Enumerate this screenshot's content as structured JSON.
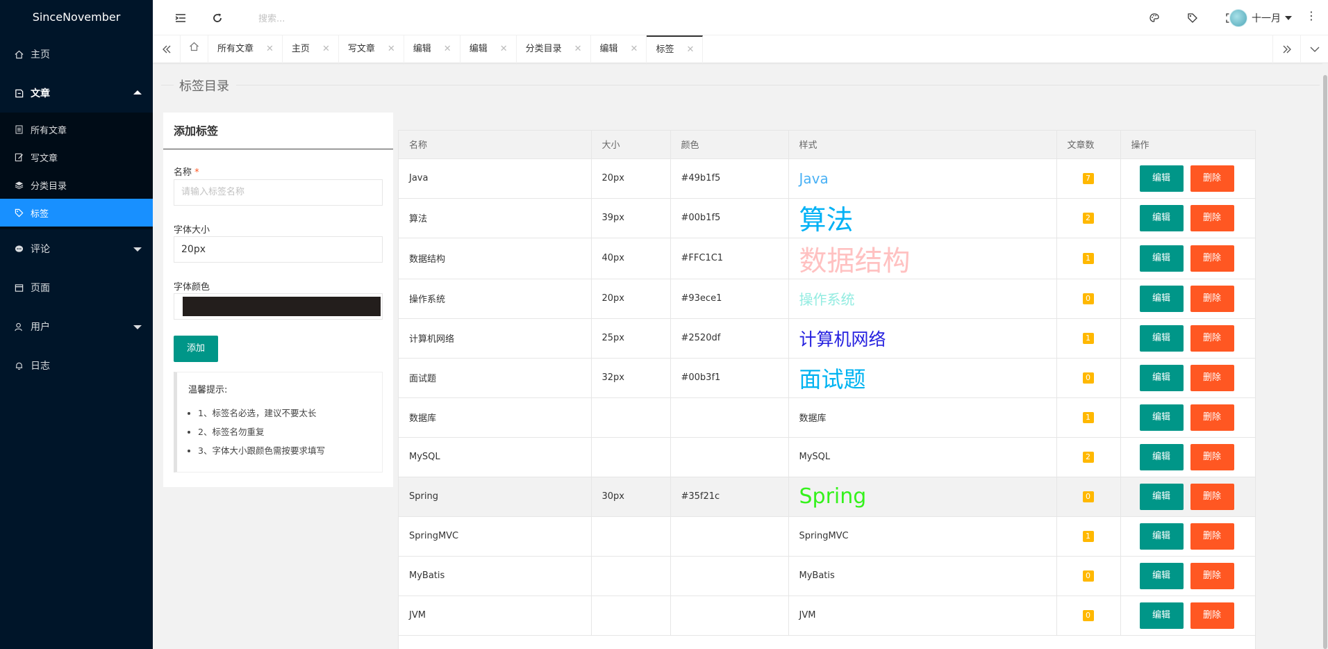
{
  "app": {
    "brand": "SinceNovember"
  },
  "sidebar": {
    "items": [
      {
        "label": "主页"
      },
      {
        "label": "文章"
      },
      {
        "label": "评论"
      },
      {
        "label": "页面"
      },
      {
        "label": "用户"
      },
      {
        "label": "日志"
      }
    ],
    "sub_items": [
      {
        "label": "所有文章"
      },
      {
        "label": "写文章"
      },
      {
        "label": "分类目录"
      },
      {
        "label": "标签"
      }
    ]
  },
  "header": {
    "search_placeholder": "搜索...",
    "user_name": "十一月"
  },
  "tabs": [
    {
      "label": "所有文章"
    },
    {
      "label": "主页"
    },
    {
      "label": "写文章"
    },
    {
      "label": "编辑"
    },
    {
      "label": "编辑"
    },
    {
      "label": "分类目录"
    },
    {
      "label": "编辑"
    },
    {
      "label": "标签"
    }
  ],
  "page": {
    "title": "标签目录"
  },
  "form": {
    "title": "添加标签",
    "name_label": "名称",
    "required_mark": "*",
    "name_placeholder": "请输入标签名称",
    "size_label": "字体大小",
    "size_value": "20px",
    "color_label": "字体颜色",
    "color_value": "#231e1c",
    "submit_label": "添加",
    "tips_title": "温馨提示:",
    "tips": [
      "1、标签名必选，建议不要太长",
      "2、标签名勿重复",
      "3、字体大小跟颜色需按要求填写"
    ]
  },
  "table": {
    "headers": [
      "名称",
      "大小",
      "颜色",
      "样式",
      "文章数",
      "操作"
    ],
    "edit_label": "编辑",
    "delete_label": "删除",
    "rows": [
      {
        "name": "Java",
        "size": "20px",
        "color": "#49b1f5",
        "style_text": "Java",
        "count": "7"
      },
      {
        "name": "算法",
        "size": "39px",
        "color": "#00b1f5",
        "style_text": "算法",
        "count": "2"
      },
      {
        "name": "数据结构",
        "size": "40px",
        "color": "#FFC1C1",
        "style_text": "数据结构",
        "count": "1"
      },
      {
        "name": "操作系统",
        "size": "20px",
        "color": "#93ece1",
        "style_text": "操作系统",
        "count": "0"
      },
      {
        "name": "计算机网络",
        "size": "25px",
        "color": "#2520df",
        "style_text": "计算机网络",
        "count": "1"
      },
      {
        "name": "面试题",
        "size": "32px",
        "color": "#00b3f1",
        "style_text": "面试题",
        "count": "0"
      },
      {
        "name": "数据库",
        "size": "",
        "color": "",
        "style_text": "数据库",
        "count": "1"
      },
      {
        "name": "MySQL",
        "size": "",
        "color": "",
        "style_text": "MySQL",
        "count": "2"
      },
      {
        "name": "Spring",
        "size": "30px",
        "color": "#35f21c",
        "style_text": "Spring",
        "count": "0"
      },
      {
        "name": "SpringMVC",
        "size": "",
        "color": "",
        "style_text": "SpringMVC",
        "count": "1"
      },
      {
        "name": "MyBatis",
        "size": "",
        "color": "",
        "style_text": "MyBatis",
        "count": "0"
      },
      {
        "name": "JVM",
        "size": "",
        "color": "",
        "style_text": "JVM",
        "count": "0"
      }
    ]
  }
}
